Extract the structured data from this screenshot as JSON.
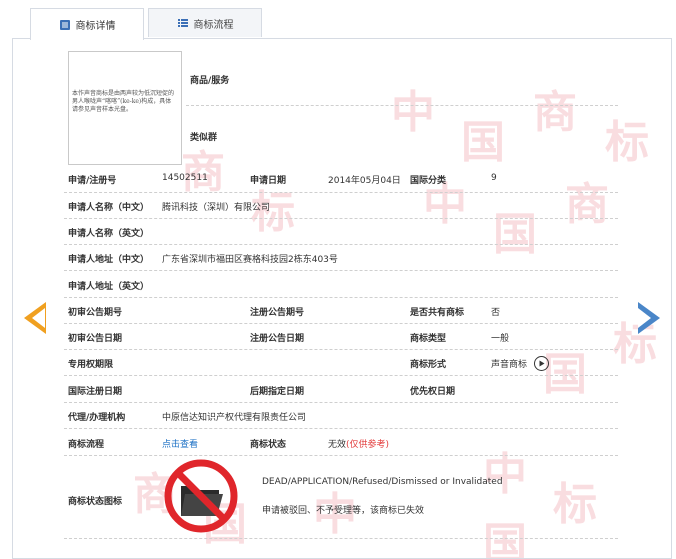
{
  "tabs": [
    {
      "label": "商标详情",
      "icon": "document-icon",
      "active": true
    },
    {
      "label": "商标流程",
      "icon": "list-icon",
      "active": false
    }
  ],
  "image_text": "本作声音商标是由两声较为低沉短促的男人喉咙声“喀喀”(ke-ke)构成，具体请参见声音样本光盘。",
  "goods_label": "商品/服务",
  "similar_group_label": "类似群",
  "fields": {
    "app_no_label": "申请/注册号",
    "app_no": "14502511",
    "app_date_label": "申请日期",
    "app_date": "2014年05月04日",
    "intl_class_label": "国际分类",
    "intl_class": "9",
    "applicant_cn_label": "申请人名称（中文）",
    "applicant_cn": "腾讯科技（深圳）有限公司",
    "applicant_en_label": "申请人名称（英文）",
    "address_cn_label": "申请人地址（中文）",
    "address_cn": "广东省深圳市福田区赛格科技园2栋东403号",
    "address_en_label": "申请人地址（英文）",
    "prelim_no_label": "初审公告期号",
    "reg_no_label": "注册公告期号",
    "shared_label": "是否共有商标",
    "shared": "否",
    "prelim_date_label": "初审公告日期",
    "reg_date_label": "注册公告日期",
    "tm_type_label": "商标类型",
    "tm_type": "一般",
    "exclusive_label": "专用权期限",
    "tm_form_label": "商标形式",
    "tm_form": "声音商标",
    "intl_reg_label": "国际注册日期",
    "later_label": "后期指定日期",
    "priority_label": "优先权日期",
    "agent_label": "代理/办理机构",
    "agent": "中原信达知识产权代理有限责任公司",
    "process_label": "商标流程",
    "process_link": "点击查看",
    "status_label": "商标状态",
    "status": "无效",
    "status_note": "(仅供参考)",
    "status_icon_label": "商标状态图标",
    "status_en": "DEAD/APPLICATION/Refused/Dismissed or Invalidated",
    "status_cn": "申请被驳回、不予受理等，该商标已失效"
  },
  "watermark_chars": [
    "中",
    "国",
    "商",
    "标"
  ],
  "colors": {
    "watermark": "#f9dde0",
    "link": "#1a6fc4",
    "status_red": "#e23b3b",
    "arrow_left": "#f0a020",
    "arrow_right": "#4a86c8",
    "prohibit_red": "#e0262b"
  }
}
